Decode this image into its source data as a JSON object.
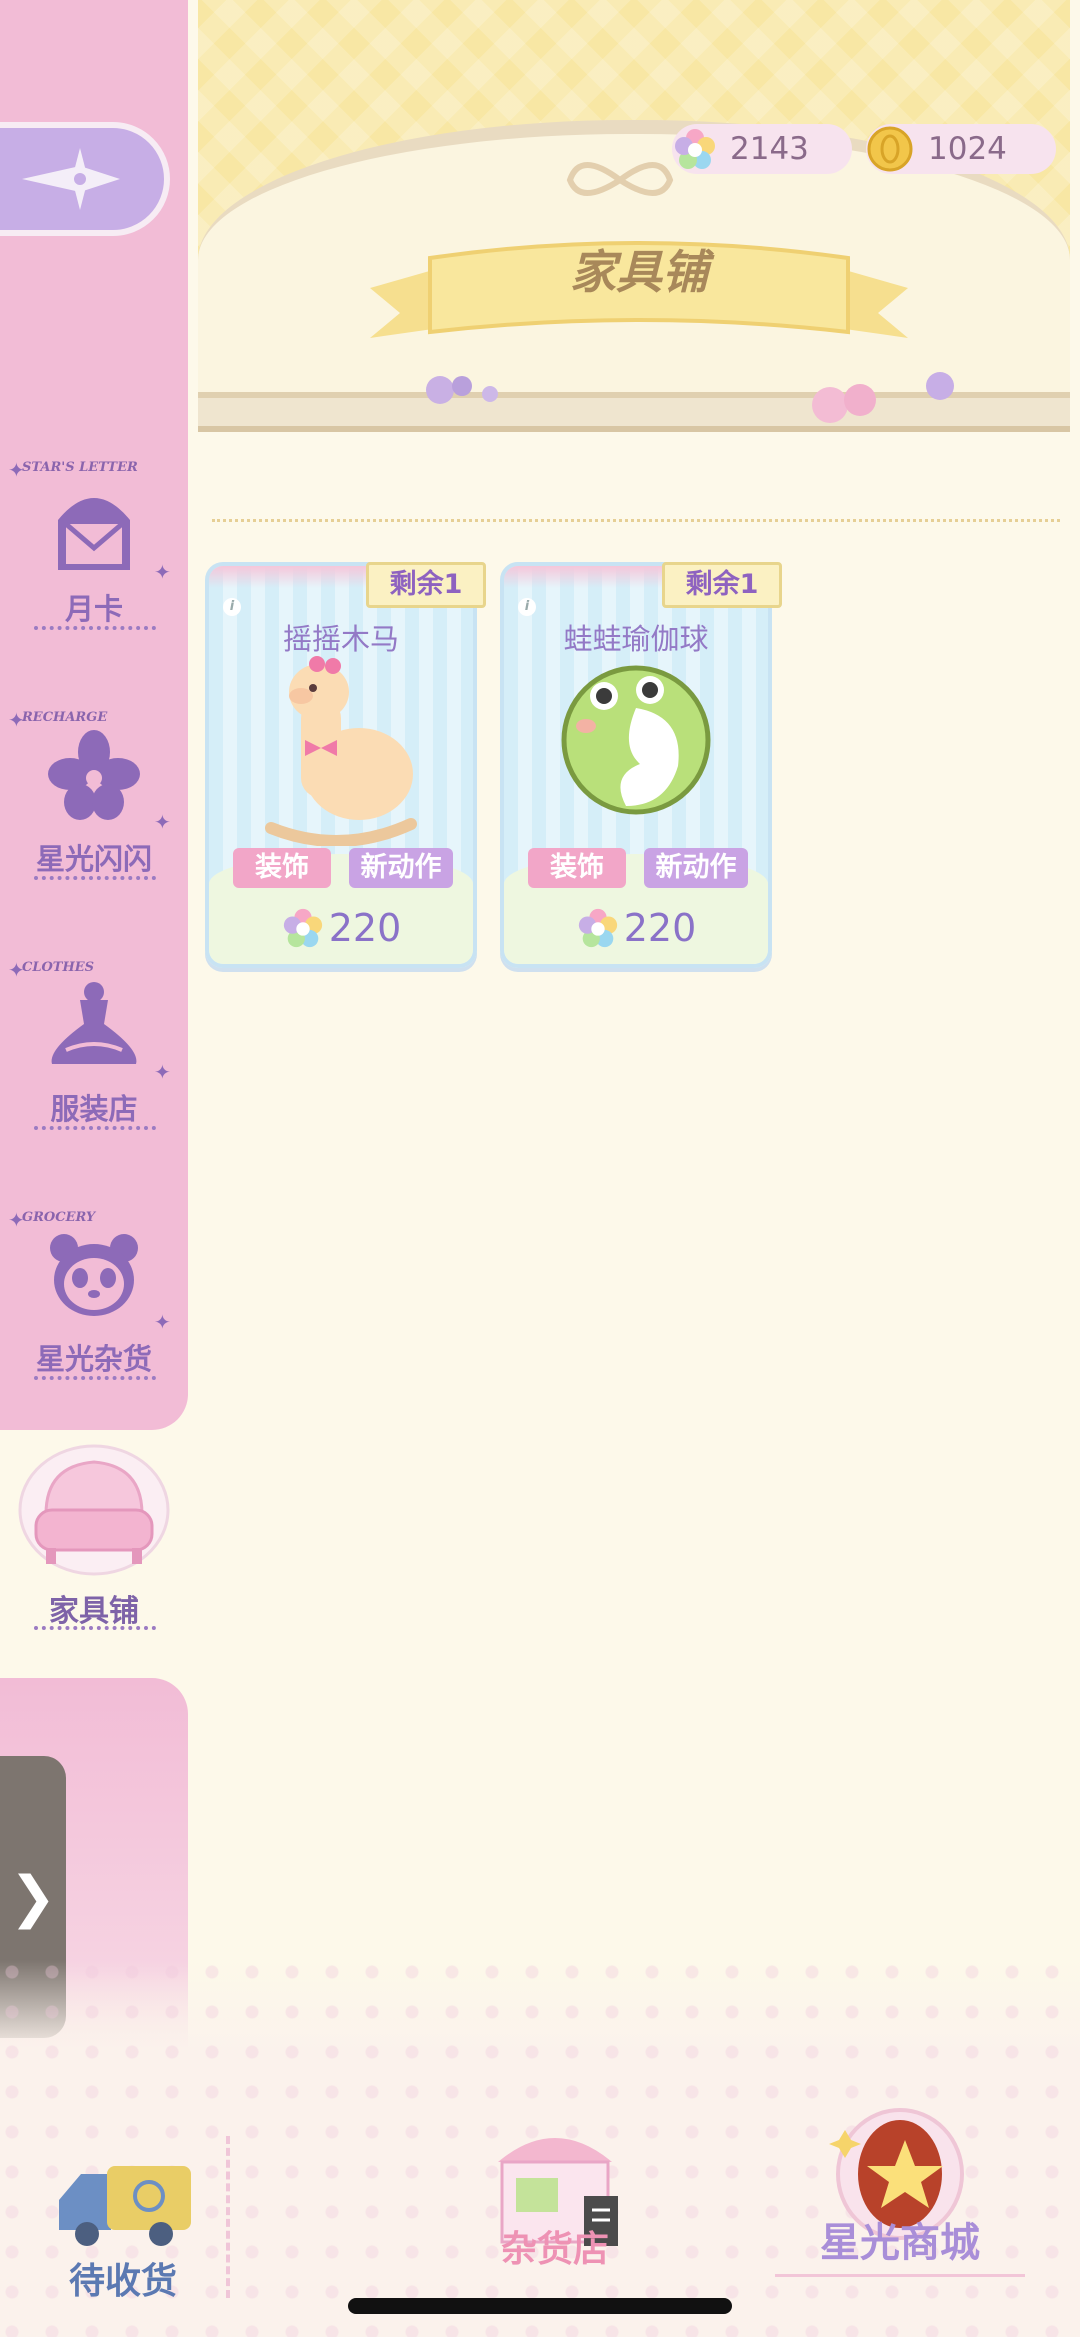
{
  "header": {
    "title": "家具铺",
    "currencies": [
      {
        "name": "star-gem",
        "value": "2143"
      },
      {
        "name": "gold-coin",
        "value": "1024"
      }
    ]
  },
  "sidebar": {
    "items": [
      {
        "tag": "STAR'S LETTER",
        "label": "月卡",
        "icon": "letter-icon"
      },
      {
        "tag": "RECHARGE",
        "label": "星光闪闪",
        "icon": "flower-icon"
      },
      {
        "tag": "CLOTHES",
        "label": "服装店",
        "icon": "dress-icon"
      },
      {
        "tag": "GROCERY",
        "label": "星光杂货",
        "icon": "panda-icon"
      }
    ],
    "active": {
      "label": "家具铺",
      "icon": "sofa-icon"
    }
  },
  "cards": [
    {
      "remain": "剩余1",
      "name": "摇摇木马",
      "tags": [
        "装饰",
        "新动作"
      ],
      "price": "220",
      "art": "alpaca-rocking-horse"
    },
    {
      "remain": "剩余1",
      "name": "蛙蛙瑜伽球",
      "tags": [
        "装饰",
        "新动作"
      ],
      "price": "220",
      "art": "frog-yoga-ball"
    }
  ],
  "bottom_nav": {
    "pending": "待收货",
    "grocery": "杂货店",
    "mall": "星光商城"
  },
  "colors": {
    "sidebar": "#f2bcd6",
    "accent_purple": "#8d6ab8",
    "banner_yellow": "#f8e7a4",
    "background": "#fdf9ea"
  }
}
